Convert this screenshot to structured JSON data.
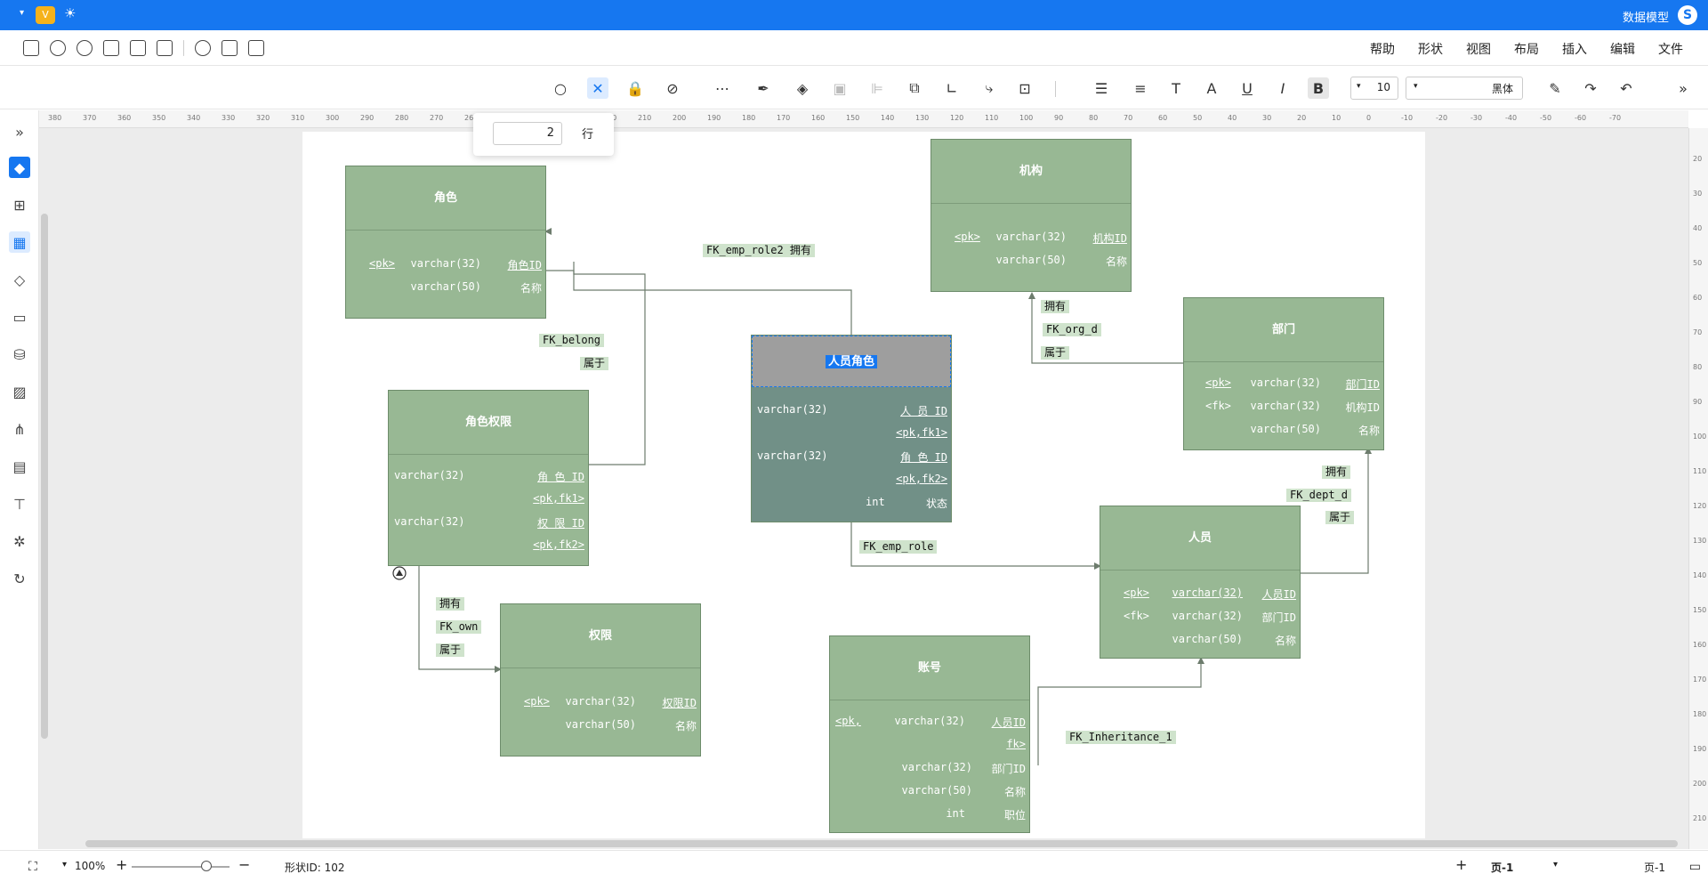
{
  "titlebar": {
    "app_title": "数据模型",
    "vip_icon": "V",
    "caret": "▾"
  },
  "menu": [
    "文件",
    "编辑",
    "插入",
    "布局",
    "视图",
    "形状",
    "帮助"
  ],
  "toolbar": {
    "font": "黑体",
    "font_size": "10",
    "bold": "B",
    "italic": "I",
    "underline": "U",
    "font_color": "A",
    "text_t": "T"
  },
  "popup": {
    "label": "行",
    "value": "2"
  },
  "entities": {
    "role": {
      "title": "角色",
      "rows": [
        [
          "角色ID",
          "varchar(32)",
          "<pk>"
        ],
        [
          "名称",
          "varchar(50)",
          ""
        ]
      ]
    },
    "org": {
      "title": "机构",
      "rows": [
        [
          "机构ID",
          "varchar(32)",
          "<pk>"
        ],
        [
          "名称",
          "varchar(50)",
          ""
        ]
      ]
    },
    "dept": {
      "title": "部门",
      "rows": [
        [
          "部门ID",
          "varchar(32)",
          "<pk>"
        ],
        [
          "机构ID",
          "varchar(32)",
          "<fk>"
        ],
        [
          "名称",
          "varchar(50)",
          ""
        ]
      ]
    },
    "emp_role": {
      "title": "人员角色",
      "rows": [
        [
          "人 员 ID",
          "varchar(32)"
        ],
        [
          "<pk,fk1>",
          ""
        ],
        [
          "角 色 ID",
          "varchar(32)"
        ],
        [
          "<pk,fk2>",
          ""
        ],
        [
          "状态",
          "int"
        ]
      ]
    },
    "role_perm": {
      "title": "角色权限",
      "rows": [
        [
          "角 色 ID",
          "varchar(32)"
        ],
        [
          "<pk,fk1>",
          ""
        ],
        [
          "权 限 ID",
          "varchar(32)"
        ],
        [
          "<pk,fk2>",
          ""
        ]
      ]
    },
    "emp": {
      "title": "人员",
      "rows": [
        [
          "人员ID",
          "varchar(32)",
          "<pk>"
        ],
        [
          "部门ID",
          "varchar(32)",
          "<fk>"
        ],
        [
          "名称",
          "varchar(50)",
          ""
        ]
      ]
    },
    "perm": {
      "title": "权限",
      "rows": [
        [
          "权限ID",
          "varchar(32)",
          "<pk>"
        ],
        [
          "名称",
          "varchar(50)",
          ""
        ]
      ]
    },
    "account": {
      "title": "账号",
      "rows": [
        [
          "人员ID",
          "varchar(32)",
          "<pk,"
        ],
        [
          "fk>",
          "",
          ""
        ],
        [
          "部门ID",
          "varchar(32)",
          ""
        ],
        [
          "名称",
          "varchar(50)",
          ""
        ],
        [
          "职位",
          "int",
          ""
        ]
      ]
    }
  },
  "labels": {
    "fk_emp_role2": "FK_emp_role2 拥有",
    "fk_belong": "FK_belong",
    "belong1": "属于",
    "own1": "拥有",
    "fk_org_d": "FK_org_d",
    "belong2": "属于",
    "own2": "拥有",
    "fk_dept_d": "FK_dept_d",
    "belong3": "属于",
    "fk_emp_role": "FK_emp_role",
    "own3": "拥有",
    "fk_own": "FK_own",
    "belong4": "属于",
    "fk_inheritance": "FK_Inheritance_1"
  },
  "status": {
    "page_tab": "页-1",
    "page_label": "页-1",
    "shape_id": "形状ID: 102",
    "zoom": "100%"
  },
  "ruler": {
    "h_ticks": [
      "380",
      "370",
      "360",
      "350",
      "340",
      "330",
      "320",
      "310",
      "300",
      "290",
      "280",
      "270",
      "260",
      "250",
      "240",
      "230",
      "220",
      "210",
      "200",
      "190",
      "180",
      "170",
      "160",
      "150",
      "140",
      "130",
      "120",
      "110",
      "100",
      "90",
      "80",
      "70",
      "60",
      "50",
      "40",
      "30",
      "20",
      "10",
      "0",
      "-10",
      "-20",
      "-30",
      "-40",
      "-50",
      "-60",
      "-70"
    ],
    "v_ticks": [
      "20",
      "30",
      "40",
      "50",
      "60",
      "70",
      "80",
      "90",
      "100",
      "110",
      "120",
      "130",
      "140",
      "150",
      "160",
      "170",
      "180",
      "190",
      "200",
      "210"
    ]
  },
  "colors": {
    "accent": "#1677f0",
    "entity_fill": "#98b894",
    "selected_fill": "#719087",
    "label_bg": "#cfe3cc"
  }
}
